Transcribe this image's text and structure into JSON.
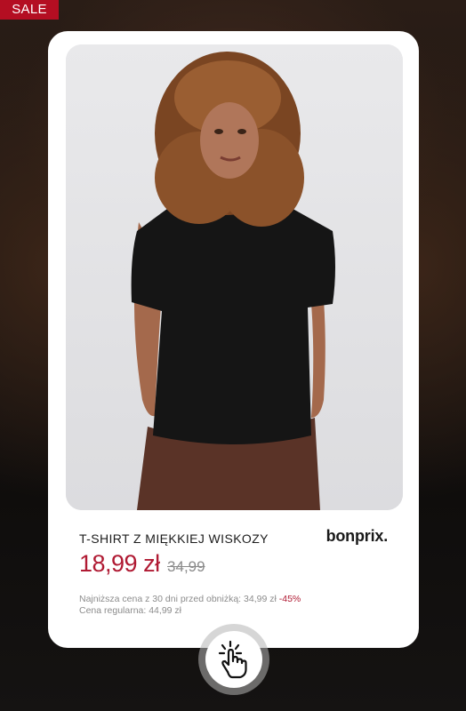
{
  "badge": {
    "label": "SALE"
  },
  "product": {
    "name": "T-SHIRT Z MIĘKKIEJ WISKOZY",
    "brand": "bonprix.",
    "price_current": "18,99 zł",
    "price_old": "34,99",
    "lowest_price_text": "Najniższa cena z 30 dni przed obniżką: 34,99 zł",
    "discount": "-45%",
    "regular_price_text": "Cena regularna: 44,99 zł"
  },
  "icons": {
    "tap": "tap-hand-icon"
  },
  "colors": {
    "sale": "#b40e22",
    "price": "#b01a33",
    "card": "#ffffff"
  }
}
